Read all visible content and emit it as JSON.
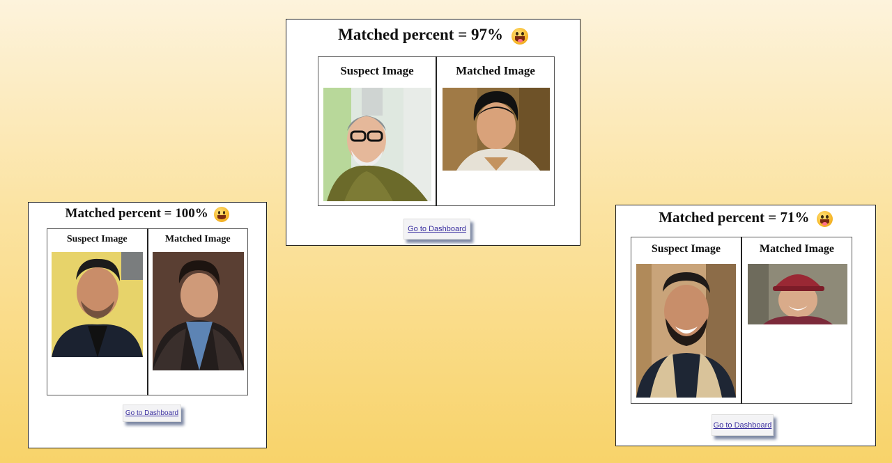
{
  "cards": [
    {
      "id": "left",
      "title": "Matched percent = 100%",
      "suspect_label": "Suspect Image",
      "matched_label": "Matched Image",
      "button_label": "Go to Dashboard"
    },
    {
      "id": "center",
      "title": "Matched percent = 97%",
      "suspect_label": "Suspect Image",
      "matched_label": "Matched Image",
      "button_label": "Go to Dashboard"
    },
    {
      "id": "right",
      "title": "Matched percent = 71%",
      "suspect_label": "Suspect Image",
      "matched_label": "Matched Image",
      "button_label": "Go to Dashboard"
    }
  ],
  "icons": {
    "title_emoji": "grinning-tongue-emoji-icon"
  },
  "colors": {
    "background_top": "#fdf3dc",
    "background_bottom": "#f8d36a",
    "link": "#3a2fa0"
  }
}
